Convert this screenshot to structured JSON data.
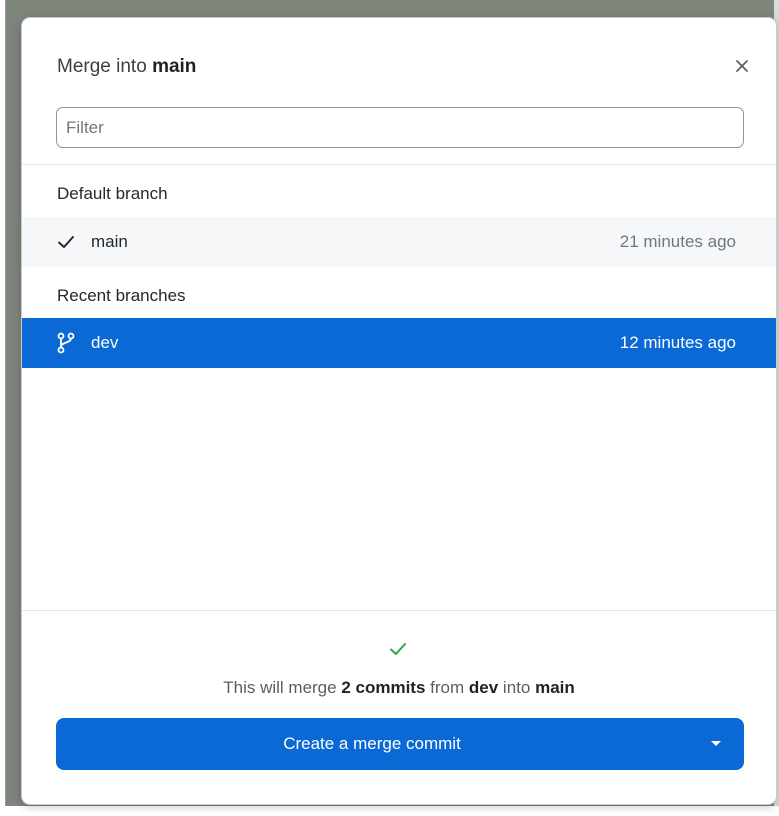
{
  "dialog": {
    "title_prefix": "Merge into",
    "title_branch": "main",
    "close_icon": "close-icon"
  },
  "filter": {
    "placeholder": "Filter",
    "value": ""
  },
  "sections": {
    "default_label": "Default branch",
    "recent_label": "Recent branches"
  },
  "branches": {
    "default": {
      "name": "main",
      "time": "21 minutes ago",
      "icon": "check-icon",
      "selected": false
    },
    "recent": [
      {
        "name": "dev",
        "time": "12 minutes ago",
        "icon": "git-branch-icon",
        "selected": true
      }
    ]
  },
  "summary": {
    "status_icon": "check-icon",
    "part1": "This will merge",
    "commits": "2 commits",
    "part2": "from",
    "source": "dev",
    "part3": "into",
    "target": "main"
  },
  "merge_button": {
    "label": "Create a merge commit",
    "caret_icon": "caret-down-icon"
  },
  "colors": {
    "accent": "#0a69d4",
    "success": "#2da44e",
    "row_hover": "#f6f7f8"
  }
}
